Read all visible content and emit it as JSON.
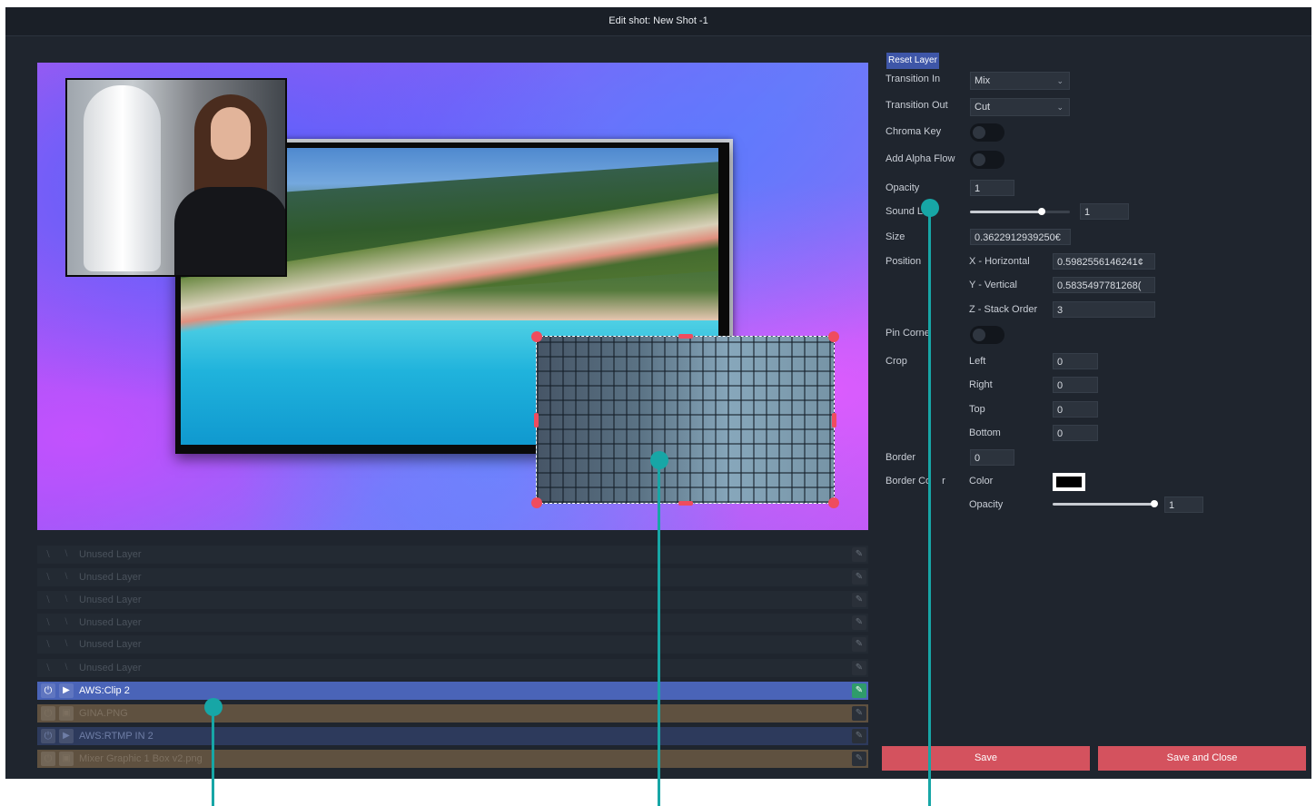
{
  "window": {
    "title": "Edit shot: New Shot -1"
  },
  "layers": [
    {
      "name": "Unused Layer",
      "kind": "unused"
    },
    {
      "name": "Unused Layer",
      "kind": "unused"
    },
    {
      "name": "Unused Layer",
      "kind": "unused"
    },
    {
      "name": "Unused Layer",
      "kind": "unused"
    },
    {
      "name": "Unused Layer",
      "kind": "unused"
    },
    {
      "name": "Unused Layer",
      "kind": "unused"
    },
    {
      "name": "AWS:Clip 2",
      "kind": "active"
    },
    {
      "name": "GINA.PNG",
      "kind": "gina"
    },
    {
      "name": "AWS:RTMP IN 2",
      "kind": "rtmp"
    },
    {
      "name": "Mixer Graphic 1 Box v2.png",
      "kind": "mixer"
    }
  ],
  "props": {
    "reset_label": "Reset Layer",
    "transition_in": {
      "label": "Transition In",
      "value": "Mix"
    },
    "transition_out": {
      "label": "Transition Out",
      "value": "Cut"
    },
    "chroma_key": {
      "label": "Chroma Key",
      "on": false
    },
    "alpha_flow": {
      "label": "Add Alpha Flow",
      "on": false
    },
    "opacity": {
      "label": "Opacity",
      "value": "1"
    },
    "sound_level": {
      "label": "Sound Le",
      "value": "1",
      "level": 0.72
    },
    "size": {
      "label": "Size",
      "value": "0.3622912939250€"
    },
    "position": {
      "label": "Position",
      "x_label": "X - Horizontal",
      "x_value": "0.5982556146241¢",
      "y_label": "Y - Vertical",
      "y_value": "0.5835497781268(",
      "z_label": "Z - Stack Order",
      "z_value": "3"
    },
    "pin_corner": {
      "label": "Pin Corne",
      "on": false
    },
    "crop": {
      "label": "Crop",
      "left_label": "Left",
      "left_value": "0",
      "right_label": "Right",
      "right_value": "0",
      "top_label": "Top",
      "top_value": "0",
      "bottom_label": "Bottom",
      "bottom_value": "0"
    },
    "border": {
      "label": "Border",
      "value": "0"
    },
    "border_color": {
      "label": "Border Co",
      "label_tail": "r",
      "color_label": "Color",
      "color": "#000000",
      "opacity_label": "Opacity",
      "opacity_value": "1",
      "opacity_level": 0.97
    }
  },
  "footer": {
    "save_label": "Save",
    "save_close_label": "Save and Close"
  },
  "colors": {
    "accent_blue": "#3e56a8",
    "save_red": "#d4525e",
    "handle_red": "#ef4c5e",
    "callout_teal": "#17a6a6"
  },
  "icons": {
    "power": "power-icon",
    "video": "video-camera-icon",
    "image": "image-icon",
    "edit": "edit-icon",
    "disabled": "disabled-icon",
    "chevron": "chevron-down-icon"
  }
}
